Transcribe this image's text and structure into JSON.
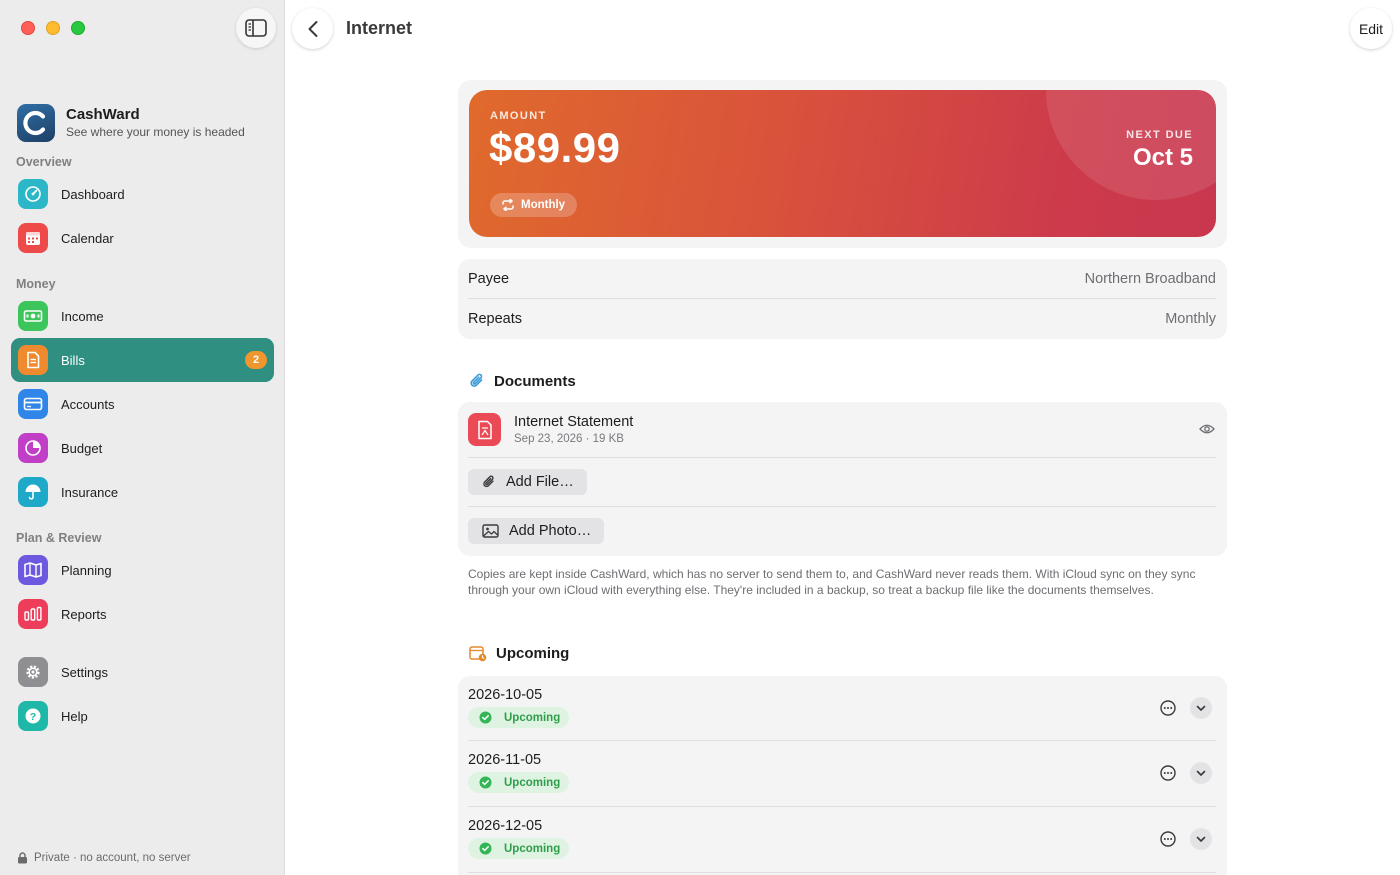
{
  "sidebar": {
    "brand": {
      "name": "CashWard",
      "tagline": "See where your money is headed"
    },
    "sections": [
      {
        "label": "Overview"
      },
      {
        "label": "Money"
      },
      {
        "label": "Plan & Review"
      }
    ],
    "items": [
      {
        "label": "Dashboard",
        "icon": "dashboard-gauge-icon",
        "color": "#2cb7c9"
      },
      {
        "label": "Calendar",
        "icon": "calendar-icon",
        "color": "#ee4a4a"
      },
      {
        "label": "Income",
        "icon": "banknote-icon",
        "color": "#3cc55a"
      },
      {
        "label": "Bills",
        "icon": "document-icon",
        "color": "#f08a2e",
        "badge": "2",
        "active": true
      },
      {
        "label": "Accounts",
        "icon": "credit-card-icon",
        "color": "#2f86e8"
      },
      {
        "label": "Budget",
        "icon": "pie-chart-icon",
        "color": "#c13ec6"
      },
      {
        "label": "Insurance",
        "icon": "umbrella-icon",
        "color": "#1ea9c8"
      },
      {
        "label": "Planning",
        "icon": "map-icon",
        "color": "#6d59e0"
      },
      {
        "label": "Reports",
        "icon": "bar-chart-icon",
        "color": "#ee3d5a"
      },
      {
        "label": "Settings",
        "icon": "gear-icon",
        "color": "#8e8e93"
      },
      {
        "label": "Help",
        "icon": "question-icon",
        "color": "#1fb8a8"
      }
    ],
    "footer": "Private · no account, no server"
  },
  "header": {
    "title": "Internet",
    "edit_label": "Edit"
  },
  "bill": {
    "amount_label": "AMOUNT",
    "amount": "$89.99",
    "frequency": "Monthly",
    "next_due_label": "NEXT DUE",
    "next_due": "Oct 5",
    "gradient_colors": [
      "#e06a2c",
      "#c9374f"
    ]
  },
  "details": [
    {
      "key": "Payee",
      "value": "Northern Broadband"
    },
    {
      "key": "Repeats",
      "value": "Monthly"
    }
  ],
  "documents": {
    "heading": "Documents",
    "files": [
      {
        "name": "Internet Statement",
        "meta": "Sep 23, 2026 · 19 KB"
      }
    ],
    "add_file_label": "Add File…",
    "add_photo_label": "Add Photo…",
    "note": "Copies are kept inside CashWard, which has no server to send them to, and CashWard never reads them. With iCloud sync on they sync through your own iCloud with everything else. They're included in a backup, so treat a backup file like the documents themselves."
  },
  "upcoming": {
    "heading": "Upcoming",
    "items": [
      {
        "date": "2026-10-05",
        "status": "Upcoming"
      },
      {
        "date": "2026-11-05",
        "status": "Upcoming"
      },
      {
        "date": "2026-12-05",
        "status": "Upcoming"
      }
    ]
  }
}
